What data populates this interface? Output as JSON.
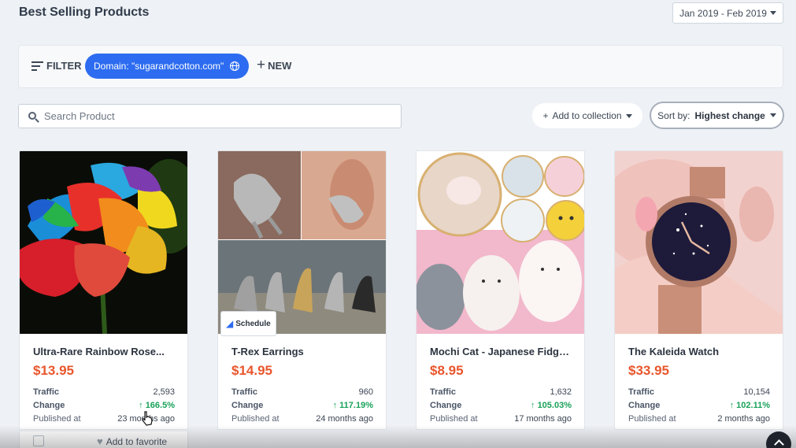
{
  "header": {
    "title": "Best Selling Products",
    "date_range": "Jan 2019 - Feb 2019"
  },
  "filter_bar": {
    "filter_label": "FILTER",
    "chip_label": "Domain: \"sugarandcotton.com\"",
    "new_label": "NEW"
  },
  "toolbar": {
    "search_placeholder": "Search Product",
    "add_collection_label": "Add to collection",
    "sort_prefix": "Sort by:",
    "sort_value": "Highest change"
  },
  "stat_labels": {
    "traffic": "Traffic",
    "change": "Change",
    "published": "Published at"
  },
  "products": [
    {
      "title": "Ultra-Rare Rainbow Rose...",
      "price": "$13.95",
      "traffic": "2,593",
      "change": "166.5%",
      "published": "23 months ago"
    },
    {
      "title": "T-Rex Earrings",
      "price": "$14.95",
      "traffic": "960",
      "change": "117.19%",
      "published": "24 months ago"
    },
    {
      "title": "Mochi Cat - Japanese Fidget...",
      "price": "$8.95",
      "traffic": "1,632",
      "change": "105.03%",
      "published": "17 months ago"
    },
    {
      "title": "The Kaleida Watch",
      "price": "$33.95",
      "traffic": "10,154",
      "change": "102.11%",
      "published": "2 months ago"
    }
  ],
  "schedule_label": "Schedule",
  "favorite_label": "Add to favorite",
  "colors": {
    "accent": "#2d6cf0",
    "price": "#e8562c",
    "positive": "#19a25a",
    "background": "#eef1f5"
  }
}
